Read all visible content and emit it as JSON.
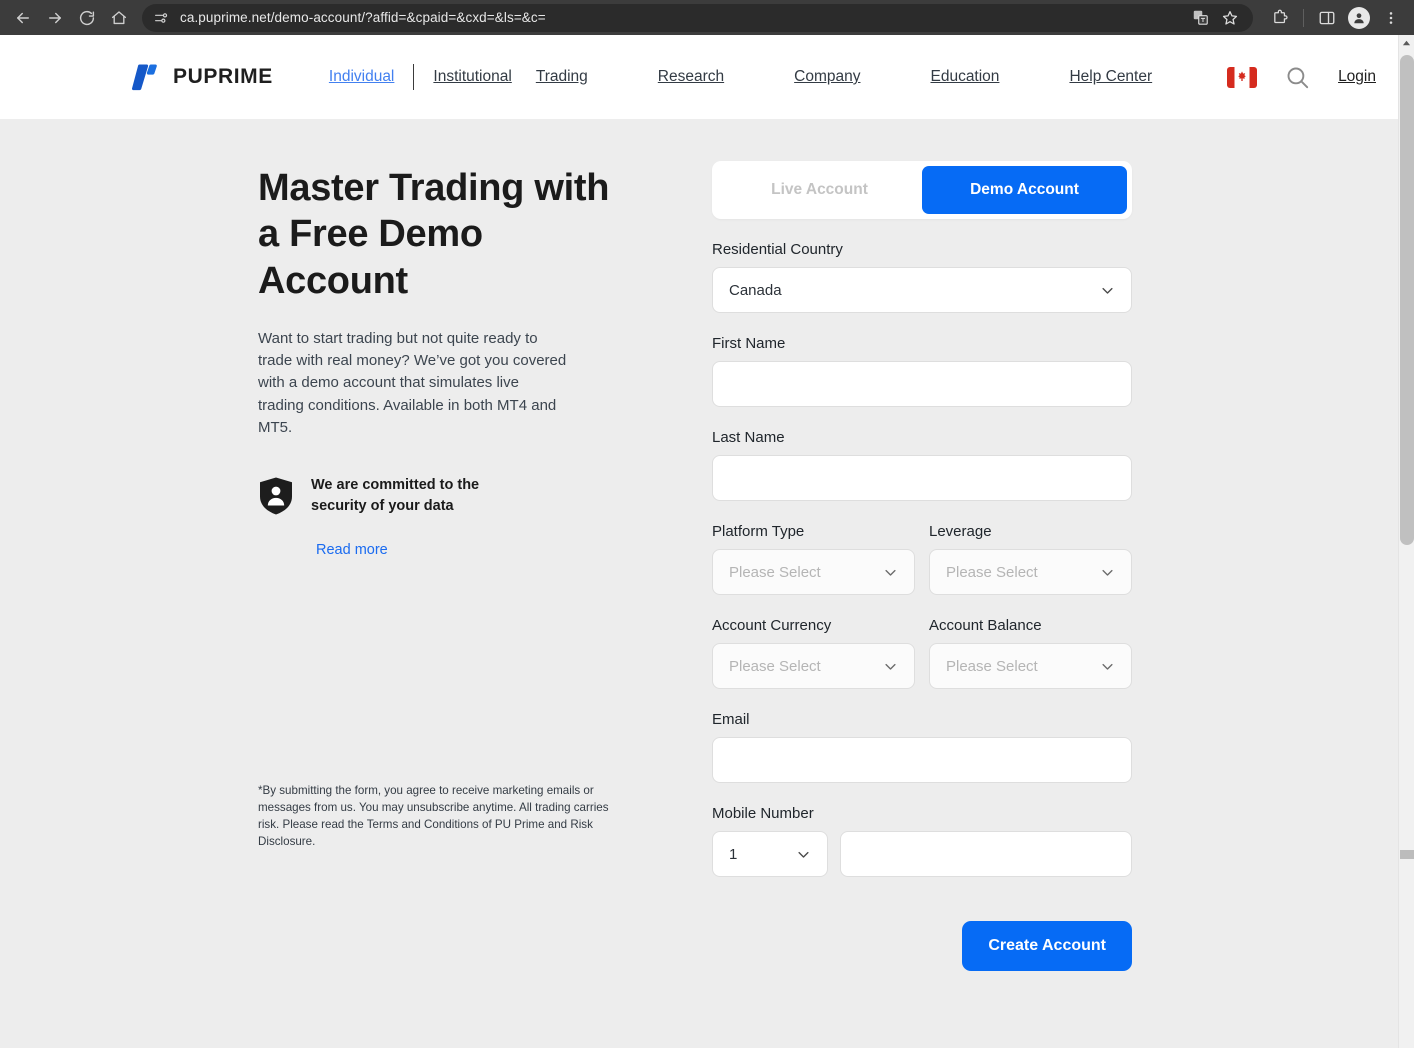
{
  "browser": {
    "back_icon": "back-arrow-icon",
    "forward_icon": "forward-arrow-icon",
    "reload_icon": "reload-icon",
    "home_icon": "home-icon",
    "site_info_icon": "site-settings-icon",
    "url": "ca.puprime.net/demo-account/?affid=&cpaid=&cxd=&ls=&c=",
    "translate_icon": "translate-icon",
    "bookmark_icon": "bookmark-star-icon",
    "extensions_icon": "extensions-puzzle-icon",
    "side_panel_icon": "side-panel-icon",
    "profile_icon": "profile-avatar-icon",
    "menu_icon": "three-dot-menu-icon"
  },
  "header": {
    "logo_text": "PUPRIME",
    "nav": [
      {
        "label": "Individual",
        "active": true
      },
      {
        "label": "Institutional",
        "active": false
      },
      {
        "label": "Trading",
        "active": false
      },
      {
        "label": "Research",
        "active": false
      },
      {
        "label": "Company",
        "active": false
      },
      {
        "label": "Education",
        "active": false
      },
      {
        "label": "Help Center",
        "active": false
      }
    ],
    "flag_country": "Canada",
    "search_icon": "search-icon",
    "login_label": "Login"
  },
  "hero": {
    "title": "Master Trading with a Free Demo Account",
    "description": "Want to start trading but not quite ready to trade with real money? We’ve got you covered with a demo account that simulates live trading conditions. Available in both MT4 and MT5.",
    "security_icon": "shield-person-icon",
    "security_text": "We are committed to the security of your data",
    "read_more_label": "Read more",
    "disclaimer": "*By submitting the form, you agree to receive marketing emails or messages from us. You may unsubscribe anytime. All trading carries risk. Please read the Terms and Conditions of PU Prime and Risk Disclosure."
  },
  "form": {
    "tabs": [
      {
        "label": "Live Account",
        "active": false
      },
      {
        "label": "Demo Account",
        "active": true
      }
    ],
    "fields": {
      "residential_country": {
        "label": "Residential Country",
        "value": "Canada"
      },
      "first_name": {
        "label": "First Name",
        "value": ""
      },
      "last_name": {
        "label": "Last Name",
        "value": ""
      },
      "platform_type": {
        "label": "Platform Type",
        "placeholder": "Please Select"
      },
      "leverage": {
        "label": "Leverage",
        "placeholder": "Please Select"
      },
      "account_currency": {
        "label": "Account Currency",
        "placeholder": "Please Select"
      },
      "account_balance": {
        "label": "Account Balance",
        "placeholder": "Please Select"
      },
      "email": {
        "label": "Email",
        "value": ""
      },
      "mobile_number": {
        "label": "Mobile Number",
        "country_code": "1",
        "value": ""
      }
    },
    "submit_label": "Create Account",
    "accent_color": "#066bf5"
  }
}
